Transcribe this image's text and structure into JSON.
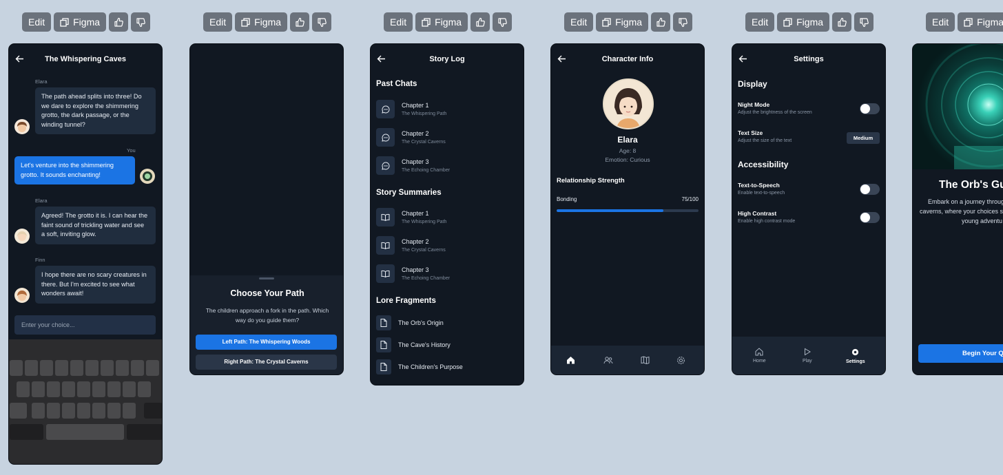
{
  "toolbar": {
    "edit_label": "Edit",
    "figma_label": "Figma"
  },
  "chat": {
    "title": "The Whispering Caves",
    "messages": [
      {
        "sender": "Elara",
        "text_lines": [
          "The path ahead splits into three! Do",
          "we dare to explore the shimmering",
          "grotto, the dark passage, or the",
          "winding tunnel?"
        ]
      },
      {
        "sender": "You",
        "text_lines": [
          "Let's venture into the shimmering",
          "grotto. It sounds enchanting!"
        ]
      },
      {
        "sender": "Elara",
        "text_lines": [
          "Agreed! The grotto it is. I can hear the",
          "faint sound of trickling water and see",
          "a soft, inviting glow."
        ]
      },
      {
        "sender": "Finn",
        "text_lines": [
          "I hope there are no scary creatures in",
          "there. But I'm excited to see what",
          "wonders await!"
        ]
      }
    ],
    "input_placeholder": "Enter your choice..."
  },
  "path": {
    "title": "Choose Your Path",
    "desc_lines": [
      "The children approach a fork in the path. Which",
      "way do you guide them?"
    ],
    "option_left": "Left Path: The Whispering Woods",
    "option_right": "Right Path: The Crystal Caverns"
  },
  "story_log": {
    "title": "Story Log",
    "past_chats_heading": "Past Chats",
    "past_chats": [
      {
        "title": "Chapter 1",
        "subtitle": "The Whispering Path"
      },
      {
        "title": "Chapter 2",
        "subtitle": "The Crystal Caverns"
      },
      {
        "title": "Chapter 3",
        "subtitle": "The Echoing Chamber"
      }
    ],
    "summaries_heading": "Story Summaries",
    "summaries": [
      {
        "title": "Chapter 1",
        "subtitle": "The Whispering Path"
      },
      {
        "title": "Chapter 2",
        "subtitle": "The Crystal Caverns"
      },
      {
        "title": "Chapter 3",
        "subtitle": "The Echoing Chamber"
      }
    ],
    "lore_heading": "Lore Fragments",
    "lore": [
      "The Orb's Origin",
      "The Cave's History",
      "The Children's Purpose"
    ]
  },
  "character": {
    "title": "Character Info",
    "name": "Elara",
    "age": "Age: 8",
    "emotion": "Emotion: Curious",
    "relationship_heading": "Relationship Strength",
    "bond_label": "Bonding",
    "bond_value_text": "75/100",
    "bond_fraction": 0.75
  },
  "settings": {
    "title": "Settings",
    "display_heading": "Display",
    "night_mode_title": "Night Mode",
    "night_mode_desc": "Adjust the brightness of the screen",
    "text_size_title": "Text Size",
    "text_size_desc": "Adjust the size of the text",
    "text_size_value": "Medium",
    "accessibility_heading": "Accessibility",
    "tts_title": "Text-to-Speech",
    "tts_desc": "Enable text-to-speech",
    "contrast_title": "High Contrast",
    "contrast_desc": "Enable high contrast mode",
    "nav_home": "Home",
    "nav_play": "Play",
    "nav_settings": "Settings"
  },
  "orb": {
    "title": "The Orb's Gu",
    "desc_lines": [
      "Embark on a journey throug",
      "caverns, where your choices s",
      "young adventu"
    ],
    "button": "Begin Your Qu"
  },
  "colors": {
    "accent": "#1b74e4",
    "card_bg": "#111822",
    "page_bg": "#c7d3e0"
  }
}
